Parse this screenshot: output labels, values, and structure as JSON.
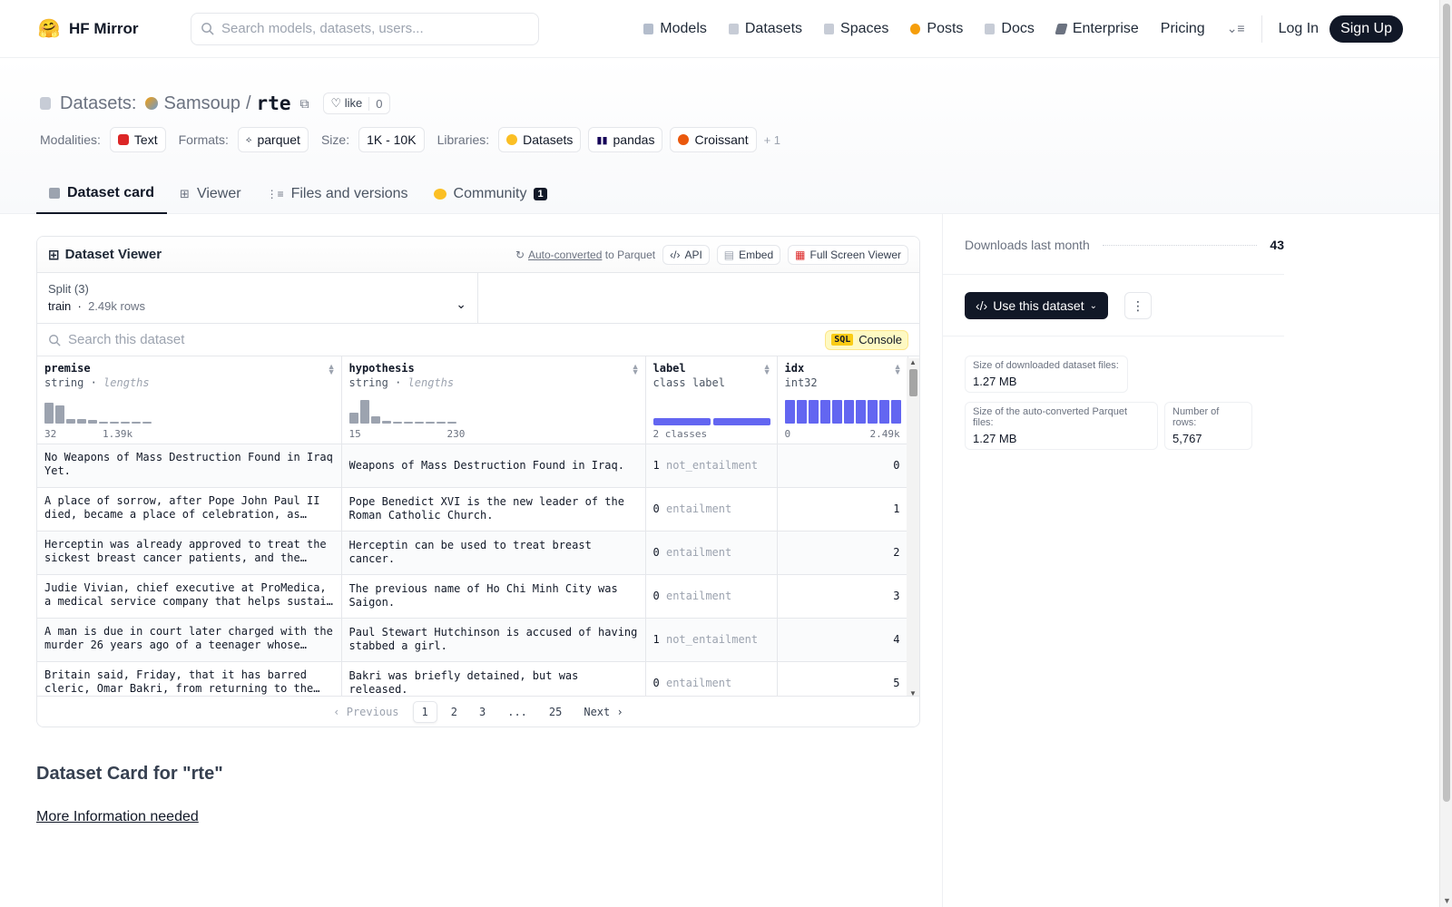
{
  "app": {
    "name": "HF Mirror"
  },
  "search": {
    "placeholder": "Search models, datasets, users..."
  },
  "nav": {
    "models": "Models",
    "datasets": "Datasets",
    "spaces": "Spaces",
    "posts": "Posts",
    "docs": "Docs",
    "enterprise": "Enterprise",
    "pricing": "Pricing",
    "login": "Log In",
    "signup": "Sign Up"
  },
  "repo": {
    "kind": "Datasets:",
    "owner": "Samsoup",
    "slash": "/",
    "name": "rte",
    "like_label": "like",
    "likes": "0"
  },
  "tags": {
    "modalities_label": "Modalities:",
    "modality": "Text",
    "formats_label": "Formats:",
    "format": "parquet",
    "size_label": "Size:",
    "size": "1K - 10K",
    "libraries_label": "Libraries:",
    "lib1": "Datasets",
    "lib2": "pandas",
    "lib3": "Croissant",
    "more": "+ 1"
  },
  "tabs": {
    "card": "Dataset card",
    "viewer": "Viewer",
    "files": "Files and versions",
    "community": "Community",
    "community_count": "1"
  },
  "viewer": {
    "title": "Dataset Viewer",
    "auto": "Auto-converted",
    "to_parquet": "to Parquet",
    "api": "API",
    "embed": "Embed",
    "fullscreen": "Full Screen Viewer",
    "split_label": "Split (3)",
    "split_value": "train",
    "split_rows": "2.49k rows",
    "search_placeholder": "Search this dataset",
    "sql": "SQL",
    "console": "Console"
  },
  "columns": [
    {
      "name": "premise",
      "type": "string",
      "extra": "lengths",
      "min": "32",
      "max": "1.39k"
    },
    {
      "name": "hypothesis",
      "type": "string",
      "extra": "lengths",
      "min": "15",
      "max": "230"
    },
    {
      "name": "label",
      "type": "class label",
      "extra": "",
      "min": "2 classes",
      "max": ""
    },
    {
      "name": "idx",
      "type": "int32",
      "extra": "",
      "min": "0",
      "max": "2.49k"
    }
  ],
  "rows": [
    {
      "premise": "No Weapons of Mass Destruction Found in Iraq Yet.",
      "hypothesis": "Weapons of Mass Destruction Found in Iraq.",
      "label": "1",
      "label_name": "not_entailment",
      "idx": "0"
    },
    {
      "premise": "A place of sorrow, after Pope John Paul II died, became a place of celebration, as Roman…",
      "hypothesis": "Pope Benedict XVI is the new leader of the Roman Catholic Church.",
      "label": "0",
      "label_name": "entailment",
      "idx": "1"
    },
    {
      "premise": "Herceptin was already approved to treat the sickest breast cancer patients, and the…",
      "hypothesis": "Herceptin can be used to treat breast cancer.",
      "label": "0",
      "label_name": "entailment",
      "idx": "2"
    },
    {
      "premise": "Judie Vivian, chief executive at ProMedica, a medical service company that helps sustain th…",
      "hypothesis": "The previous name of Ho Chi Minh City was Saigon.",
      "label": "0",
      "label_name": "entailment",
      "idx": "3"
    },
    {
      "premise": "A man is due in court later charged with the murder 26 years ago of a teenager whose case…",
      "hypothesis": "Paul Stewart Hutchinson is accused of having stabbed a girl.",
      "label": "1",
      "label_name": "not_entailment",
      "idx": "4"
    },
    {
      "premise": "Britain said, Friday, that it has barred cleric, Omar Bakri, from returning to the…",
      "hypothesis": "Bakri was briefly detained, but was released.",
      "label": "0",
      "label_name": "entailment",
      "idx": "5"
    }
  ],
  "pager": {
    "prev": "Previous",
    "p1": "1",
    "p2": "2",
    "p3": "3",
    "ellipsis": "...",
    "last": "25",
    "next": "Next"
  },
  "card": {
    "title": "Dataset Card for \"rte\"",
    "more": "More Information needed"
  },
  "side": {
    "downloads_label": "Downloads last month",
    "downloads": "43",
    "use": "Use this dataset",
    "dl_size_label": "Size of downloaded dataset files:",
    "dl_size": "1.27 MB",
    "pq_size_label": "Size of the auto-converted Parquet files:",
    "pq_size": "1.27 MB",
    "rows_label": "Number of rows:",
    "rows": "5,767"
  },
  "histograms": {
    "premise": [
      0.9,
      0.75,
      0.2,
      0.2,
      0.15,
      0.08,
      0.05,
      0.05,
      0.05,
      0.05
    ],
    "hypothesis": [
      0.45,
      1.0,
      0.3,
      0.12,
      0.08,
      0.05,
      0.05,
      0.05,
      0.05,
      0.05
    ],
    "label_split": [
      0.5,
      0.5
    ]
  },
  "colors": {
    "accent": "#6366f1",
    "dark": "#111827"
  }
}
